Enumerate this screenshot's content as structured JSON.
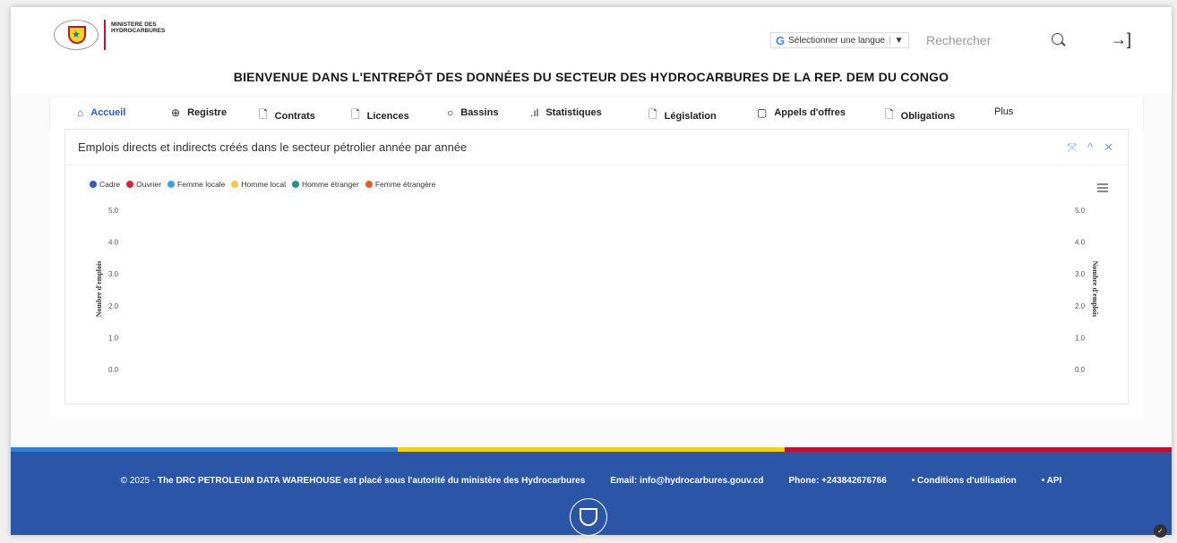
{
  "header": {
    "logo_line1": "MINISTERE DES",
    "logo_line2": "HYDROCARBURES",
    "language_label": "Sélectionner une langue",
    "language_caret": "▼",
    "search_placeholder": "Rechercher",
    "welcome": "BIENVENUE DANS L'ENTREPÔT DES DONNÉES DU SECTEUR DES HYDROCARBURES DE LA REP. DEM DU CONGO"
  },
  "nav": {
    "items": [
      {
        "label": "Accueil",
        "icon": "home-icon",
        "active": true
      },
      {
        "label": "Registre",
        "icon": "globe-icon"
      },
      {
        "label": "Contrats",
        "icon": "document-icon"
      },
      {
        "label": "Licences",
        "icon": "document-icon"
      },
      {
        "label": "Bassins",
        "icon": "circle-icon"
      },
      {
        "label": "Statistiques",
        "icon": "bar-chart-icon"
      },
      {
        "label": "Législation",
        "icon": "document-icon"
      },
      {
        "label": "Appels d'offres",
        "icon": "clipboard-icon"
      },
      {
        "label": "Obligations",
        "icon": "document-icon"
      },
      {
        "label": "Plus",
        "icon": ""
      }
    ]
  },
  "panel": {
    "title": "Emplois directs et indirects créés dans le secteur pétrolier année par année",
    "ctrl_expand": "⤧",
    "ctrl_collapse": "^",
    "ctrl_close": "✕"
  },
  "chart_data": {
    "type": "line",
    "title": "",
    "ylabel_left": "Nombre d'emplois",
    "ylabel_right": "Nombre d'emplois",
    "ylim": [
      0,
      5
    ],
    "yticks": [
      "5.0",
      "4.0",
      "3.0",
      "2.0",
      "1.0",
      "0.0"
    ],
    "grid": false,
    "legend_position": "top-left",
    "series": [
      {
        "name": "Cadre",
        "color": "#2f5fbf",
        "values": []
      },
      {
        "name": "Ouvrier",
        "color": "#e0202e",
        "values": []
      },
      {
        "name": "Femme locale",
        "color": "#3aa0e8",
        "values": []
      },
      {
        "name": "Homme local",
        "color": "#f5c842",
        "values": []
      },
      {
        "name": "Homme étranger",
        "color": "#17998a",
        "values": []
      },
      {
        "name": "Femme étrangère",
        "color": "#ee5a24",
        "values": []
      }
    ]
  },
  "footer": {
    "copyright": "© 2025 -",
    "authority": "The DRC PETROLEUM DATA WAREHOUSE est placé sous l'autorité du ministère des Hydrocarbures",
    "email": "Email: info@hydrocarbures.gouv.cd",
    "phone": "Phone: +243842676766",
    "terms": "• Conditions d'utilisation",
    "api": "• API",
    "stripe_colors": [
      "#2f7fd8",
      "#f5d20f",
      "#c8102e"
    ]
  }
}
